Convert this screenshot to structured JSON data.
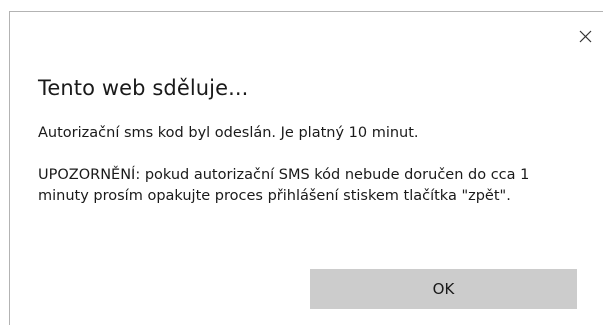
{
  "dialog": {
    "title": "Tento web sděluje...",
    "message_line1": "Autorizační sms kod byl odeslán. Je platný 10 minut.",
    "message_line2": "UPOZORNĚNÍ: pokud autorizační SMS kód nebude doručen do cca 1 minuty prosím opakujte proces přihlášení stiskem tlačítka \"zpět\".",
    "ok_label": "OK",
    "close_icon": "close-icon"
  },
  "colors": {
    "background": "#ffffff",
    "border": "#b3b3b3",
    "button_background": "#cccccc",
    "text": "#1a1a1a"
  }
}
